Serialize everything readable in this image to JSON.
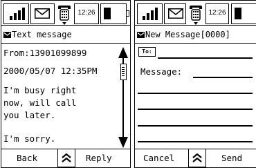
{
  "status": {
    "time": "12:26"
  },
  "read_screen": {
    "title": "Text message",
    "from_line": "From:13901099899",
    "date_line": "2000/05/07 12:35PM",
    "body_lines": [
      "I'm busy right",
      "now, will call",
      "you later."
    ],
    "closing": "I'm sorry.",
    "left_softkey": "Back",
    "right_softkey": "Reply"
  },
  "compose_screen": {
    "title": "New Message[0000]",
    "to_label": "To:",
    "message_label": "Message:",
    "left_softkey": "Cancel",
    "right_softkey": "Send"
  },
  "icons": {
    "signal": "signal-strength-icon",
    "mail": "envelope-icon",
    "phone": "phone-icon",
    "battery": "battery-icon",
    "nav": "up-down-arrows-icon",
    "scroll_up": "scroll-up-arrow-icon",
    "scroll_down": "scroll-down-arrow-icon"
  }
}
